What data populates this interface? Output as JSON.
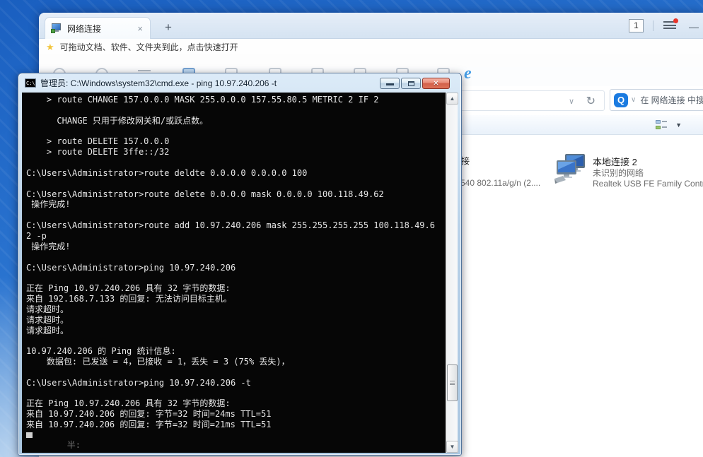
{
  "glyphs": {
    "close": "×",
    "plus": "+",
    "minimize": "—",
    "star": "★",
    "chevron_down": "∨",
    "refresh": "↻",
    "caret_down": "▼",
    "arrow_up": "▲",
    "arrow_down": "▼",
    "win_close": "✕"
  },
  "colors": {
    "desktop_blue": "#2a74d0",
    "cmd_glass": "#b8d1e8",
    "close_red": "#d2604a",
    "console_bg": "#060606",
    "console_text": "#e8e8e8",
    "search_badge_blue": "#1b7be0"
  },
  "browser": {
    "tab_title": "网络连接",
    "tab_count": "1",
    "quick_bar_text": "可拖动文档、软件、文件夹到此，点击快速打开",
    "search_engine": "Q",
    "search_placeholder": "在 网络连接 中搜索",
    "ie_icon": "e"
  },
  "explorer": {
    "left_item": {
      "name_fragment": "接",
      "device_fragment": "540 802.11a/g/n (2...."
    },
    "adapter": {
      "name": "本地连接 2",
      "status": "未识别的网络",
      "device": "Realtek USB FE Family Contro"
    }
  },
  "cmd": {
    "title": "管理员: C:\\Windows\\system32\\cmd.exe - ping  10.97.240.206 -t",
    "icon_text": "C:\\",
    "lines": [
      "    > route CHANGE 157.0.0.0 MASK 255.0.0.0 157.55.80.5 METRIC 2 IF 2",
      "",
      "      CHANGE 只用于修改网关和/或跃点数。",
      "",
      "    > route DELETE 157.0.0.0",
      "    > route DELETE 3ffe::/32",
      "",
      "C:\\Users\\Administrator>route deldte 0.0.0.0 0.0.0.0 100",
      "",
      "C:\\Users\\Administrator>route delete 0.0.0.0 mask 0.0.0.0 100.118.49.62",
      " 操作完成!",
      "",
      "C:\\Users\\Administrator>route add 10.97.240.206 mask 255.255.255.255 100.118.49.6",
      "2 -p",
      " 操作完成!",
      "",
      "C:\\Users\\Administrator>ping 10.97.240.206",
      "",
      "正在 Ping 10.97.240.206 具有 32 字节的数据:",
      "来自 192.168.7.133 的回复: 无法访问目标主机。",
      "请求超时。",
      "请求超时。",
      "请求超时。",
      "",
      "10.97.240.206 的 Ping 统计信息:",
      "    数据包: 已发送 = 4，已接收 = 1，丢失 = 3 (75% 丢失)，",
      "",
      "C:\\Users\\Administrator>ping 10.97.240.206 -t",
      "",
      "正在 Ping 10.97.240.206 具有 32 字节的数据:",
      "来自 10.97.240.206 的回复: 字节=32 时间=24ms TTL=51",
      "来自 10.97.240.206 的回复: 字节=32 时间=21ms TTL=51"
    ],
    "ghost_line": "        半:"
  }
}
